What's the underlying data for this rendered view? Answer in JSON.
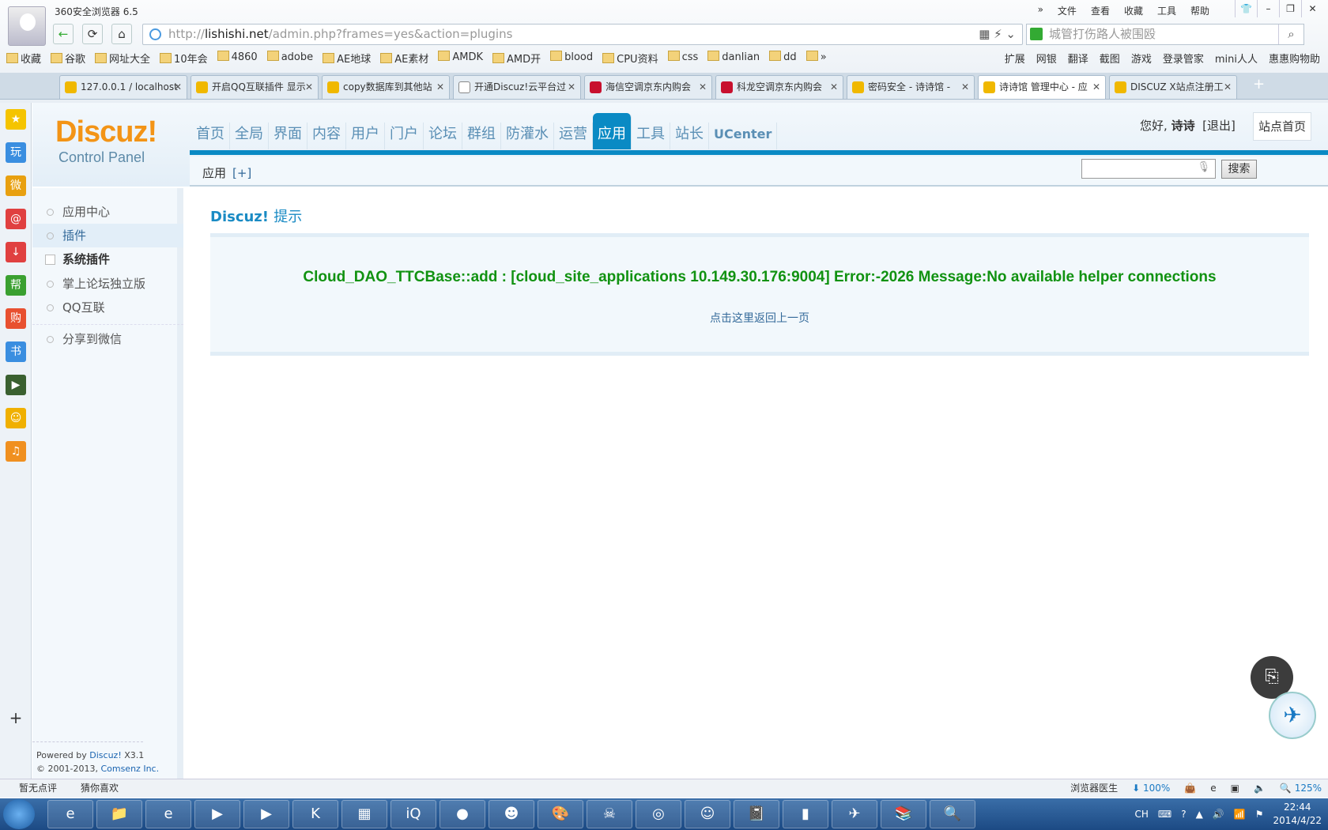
{
  "browser": {
    "title": "360安全浏览器 6.5",
    "menu": [
      "»",
      "文件",
      "查看",
      "收藏",
      "工具",
      "帮助"
    ],
    "url_host": "lishishi.net",
    "url_prefix": "http://",
    "url_path": "/admin.php?frames=yes&action=plugins",
    "search_placeholder": "城管打伤路人被围殴",
    "bookmarks": [
      "收藏",
      "谷歌",
      "网址大全",
      "10年会",
      "4860",
      "adobe",
      "AE地球",
      "AE素材",
      "AMDK",
      "AMD开",
      "blood",
      "CPU资料",
      "css",
      "danlian",
      "dd",
      "»"
    ],
    "toolbar_right": [
      "扩展",
      "网银",
      "翻译",
      "截图",
      "游戏",
      "登录管家",
      "mini人人",
      "惠惠购物助"
    ],
    "tabs": [
      {
        "label": "127.0.0.1 / localhost",
        "icon": "bulb"
      },
      {
        "label": "开启QQ互联插件 显示",
        "icon": "bulb"
      },
      {
        "label": "copy数据库到其他站",
        "icon": "bulb"
      },
      {
        "label": "开通Discuz!云平台过",
        "icon": "doc"
      },
      {
        "label": "海信空调京东内购会",
        "icon": "jd"
      },
      {
        "label": "科龙空调京东内购会",
        "icon": "jd"
      },
      {
        "label": "密码安全 - 诗诗馆 -",
        "icon": "bulb"
      },
      {
        "label": "诗诗馆 管理中心 - 应",
        "icon": "bulb",
        "active": true
      },
      {
        "label": "DISCUZ X站点注册工",
        "icon": "bulb"
      }
    ]
  },
  "left_tools": [
    {
      "g": "★",
      "c": "#f5c400"
    },
    {
      "g": "玩",
      "c": "#3a8ee0"
    },
    {
      "g": "微",
      "c": "#e8a010"
    },
    {
      "g": "@",
      "c": "#e04040"
    },
    {
      "g": "↓",
      "c": "#e04040"
    },
    {
      "g": "帮",
      "c": "#3aa030"
    },
    {
      "g": "购",
      "c": "#e85030"
    },
    {
      "g": "书",
      "c": "#3a8ee0"
    },
    {
      "g": "▶",
      "c": "#3a6030"
    },
    {
      "g": "☺",
      "c": "#f0b000"
    },
    {
      "g": "♫",
      "c": "#f09020"
    }
  ],
  "discuz": {
    "logo": "Discuz!",
    "logo_sub": "Control Panel",
    "nav": [
      "首页",
      "全局",
      "界面",
      "内容",
      "用户",
      "门户",
      "论坛",
      "群组",
      "防灌水",
      "运营",
      "应用",
      "工具",
      "站长",
      "UCenter"
    ],
    "nav_active": "应用",
    "greeting": "您好,",
    "username": "诗诗",
    "logout": "[退出]",
    "site_home": "站点首页",
    "section": "应用",
    "add": "[+]",
    "search_button": "搜索",
    "sidebar": [
      {
        "label": "应用中心"
      },
      {
        "label": "插件",
        "active": true
      },
      {
        "label": "系统插件",
        "group": true
      },
      {
        "label": "掌上论坛独立版"
      },
      {
        "label": "QQ互联"
      },
      {
        "label": "分享到微信"
      }
    ],
    "powered": "Powered by",
    "powered_link": "Discuz!",
    "version": "X3.1",
    "copyright": "© 2001-2013,",
    "company": "Comsenz Inc.",
    "msg_title": "Discuz!",
    "msg_title2": "提示",
    "error": "Cloud_DAO_TTCBase::add : [cloud_site_applications 10.149.30.176:9004] Error:-2026 Message:No available helper connections",
    "back_link": "点击这里返回上一页"
  },
  "status": {
    "left": [
      "暂无点评",
      "猜你喜欢"
    ],
    "doctor": "浏览器医生",
    "download": "100%",
    "zoom": "125%"
  },
  "taskbar": {
    "lang": "CH",
    "time": "22:44",
    "date": "2014/4/22"
  },
  "colors": {
    "accent": "#0a8ac4",
    "error": "#119211",
    "logo": "#f39416"
  }
}
